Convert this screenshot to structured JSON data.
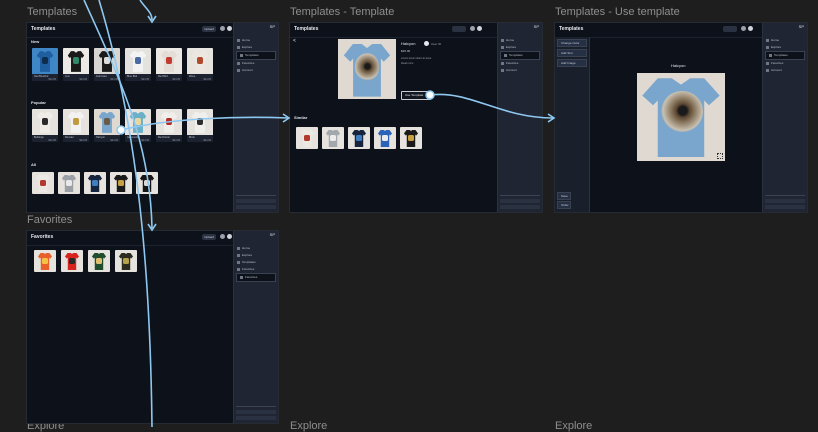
{
  "frames": {
    "templates": {
      "label": "Templates",
      "title": "Templates",
      "header_btn": "Upload",
      "sections": {
        "new": "New",
        "popular": "Popular",
        "all": "All"
      },
      "new_cards": [
        {
          "title": "Sad Bluebird",
          "price": "$24.95"
        },
        {
          "title": "Lion",
          "price": "$24.95"
        },
        {
          "title": "Astronaut",
          "price": "$24.95"
        },
        {
          "title": "Blue Bird",
          "price": "$24.95"
        },
        {
          "title": "Red Bird",
          "price": "$24.95"
        },
        {
          "title": "Wave",
          "price": "$24.95"
        }
      ],
      "popular_cards": [
        {
          "title": "Bulldogs",
          "price": "$24.95"
        },
        {
          "title": "Rooster",
          "price": "$24.95"
        },
        {
          "title": "Halcyon",
          "price": "$24.95"
        },
        {
          "title": "Geometric",
          "price": "$24.95"
        },
        {
          "title": "Red Floral",
          "price": "$24.95"
        },
        {
          "title": "Birds",
          "price": "$24.95"
        }
      ],
      "sidebar": [
        "Home",
        "Explore",
        "Templates",
        "Favorites",
        "Account"
      ]
    },
    "template_detail": {
      "label": "Templates - Template",
      "title": "Templates",
      "back": "<",
      "name": "Halcyon",
      "user": "User ID",
      "price": "$26.00",
      "desc": "Lorem ipsum dolor sit amet.",
      "desc2": "Read more",
      "use_btn": "Use Template",
      "similar": "Similar",
      "sidebar": [
        "Home",
        "Explore",
        "Templates",
        "Favorites",
        "Account"
      ]
    },
    "use_template": {
      "label": "Templates - Use template",
      "title": "Templates",
      "tools": [
        "Change Color",
        "Add Text",
        "Add Image"
      ],
      "canvas_title": "Halcyon",
      "bottom_btns": [
        "Save",
        "Order"
      ],
      "sidebar": [
        "Home",
        "Explore",
        "Templates",
        "Favorites",
        "Account"
      ]
    },
    "favorites": {
      "label": "Favorites",
      "title": "Favorites",
      "header_btn": "Upload",
      "sidebar": [
        "Home",
        "Explore",
        "Templates",
        "Favorites",
        "Favorites"
      ]
    },
    "explore": {
      "label_a": "Explore",
      "label_b": "Explore",
      "label_c": "Explore"
    }
  },
  "colors": {
    "arrow": "#8ec8f0",
    "frame_bg": "#0d1119",
    "sidebar_bg": "#1f2532",
    "canvas_bg": "#1e1e1e"
  }
}
